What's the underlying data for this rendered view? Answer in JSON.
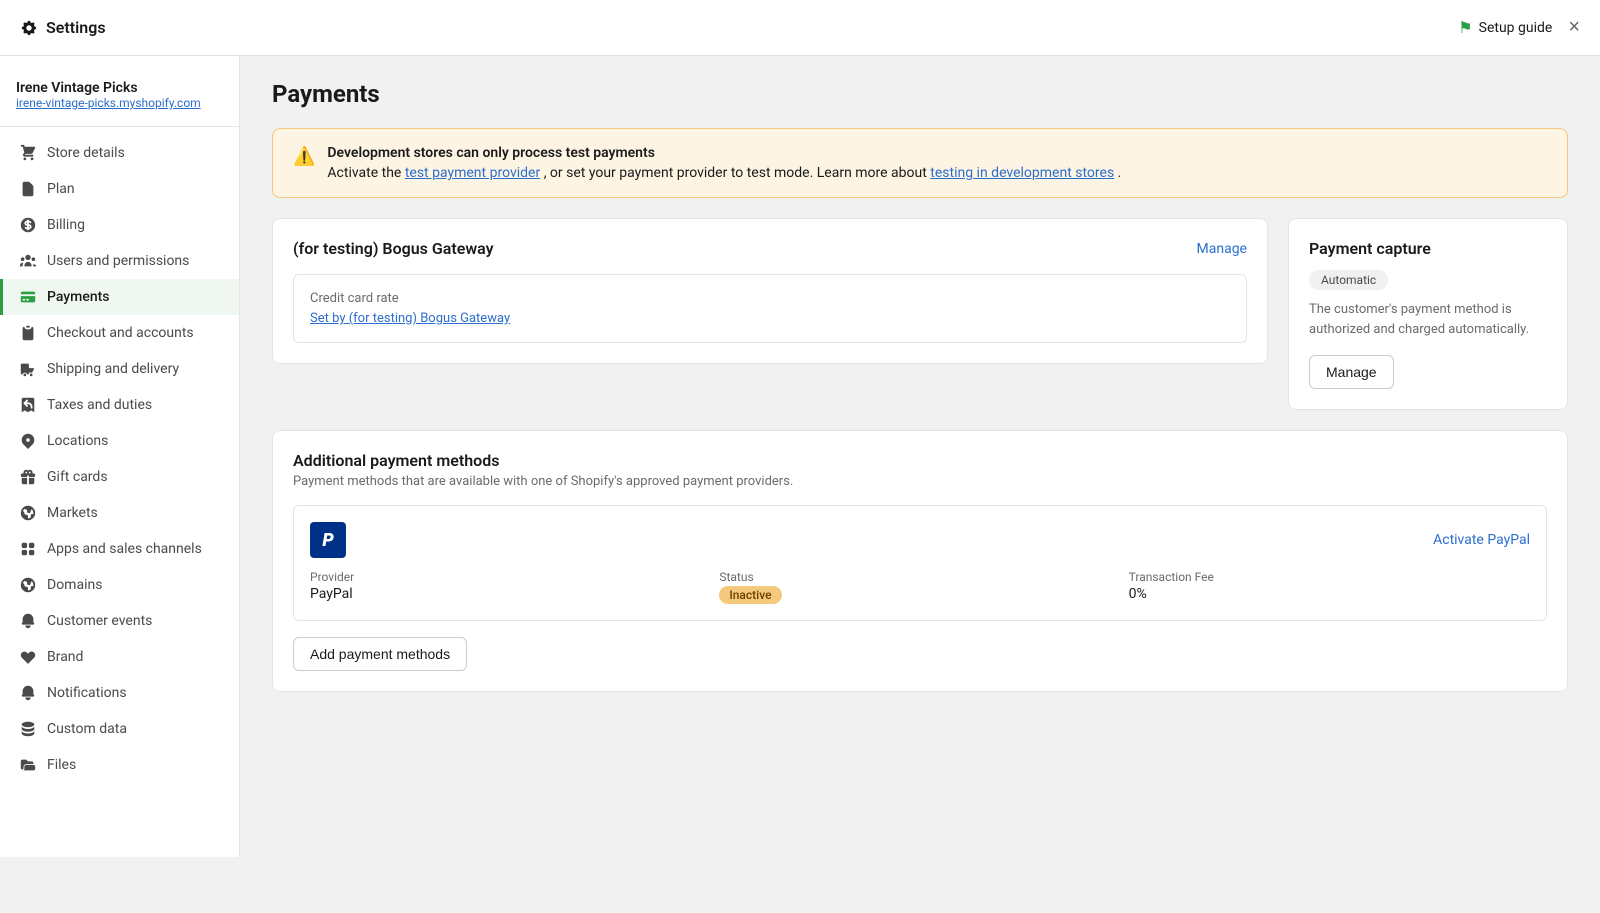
{
  "topbar": {
    "title": "Settings",
    "setup_guide_label": "Setup guide",
    "close_label": "×"
  },
  "sidebar": {
    "store_name": "Irene Vintage Picks",
    "store_url": "irene-vintage-picks.myshopify.com",
    "items": [
      {
        "id": "store-details",
        "label": "Store details",
        "icon": "store"
      },
      {
        "id": "plan",
        "label": "Plan",
        "icon": "plan"
      },
      {
        "id": "billing",
        "label": "Billing",
        "icon": "billing"
      },
      {
        "id": "users-permissions",
        "label": "Users and permissions",
        "icon": "users"
      },
      {
        "id": "payments",
        "label": "Payments",
        "icon": "payments",
        "active": true
      },
      {
        "id": "checkout-accounts",
        "label": "Checkout and accounts",
        "icon": "checkout"
      },
      {
        "id": "shipping-delivery",
        "label": "Shipping and delivery",
        "icon": "shipping"
      },
      {
        "id": "taxes-duties",
        "label": "Taxes and duties",
        "icon": "taxes"
      },
      {
        "id": "locations",
        "label": "Locations",
        "icon": "locations"
      },
      {
        "id": "gift-cards",
        "label": "Gift cards",
        "icon": "gift"
      },
      {
        "id": "markets",
        "label": "Markets",
        "icon": "markets"
      },
      {
        "id": "apps-channels",
        "label": "Apps and sales channels",
        "icon": "apps"
      },
      {
        "id": "domains",
        "label": "Domains",
        "icon": "domains"
      },
      {
        "id": "customer-events",
        "label": "Customer events",
        "icon": "events"
      },
      {
        "id": "brand",
        "label": "Brand",
        "icon": "brand"
      },
      {
        "id": "notifications",
        "label": "Notifications",
        "icon": "notifications"
      },
      {
        "id": "custom-data",
        "label": "Custom data",
        "icon": "custom"
      },
      {
        "id": "files",
        "label": "Files",
        "icon": "files"
      }
    ]
  },
  "page": {
    "title": "Payments",
    "alert": {
      "title": "Development stores can only process test payments",
      "description": "Activate the ",
      "link1_text": "test payment provider",
      "middle_text": ", or set your payment provider to test mode. Learn more about ",
      "link2_text": "testing in development stores",
      "end_text": "."
    },
    "gateway": {
      "name": "(for testing) Bogus Gateway",
      "manage_label": "Manage",
      "credit_card_rate_label": "Credit card rate",
      "credit_card_link": "Set by (for testing) Bogus Gateway"
    },
    "payment_capture": {
      "title": "Payment capture",
      "badge": "Automatic",
      "description": "The customer's payment method is authorized and charged automatically.",
      "manage_label": "Manage"
    },
    "additional_methods": {
      "title": "Additional payment methods",
      "description": "Payment methods that are available with one of Shopify's approved payment providers.",
      "paypal": {
        "activate_label": "Activate PayPal",
        "provider_label": "Provider",
        "provider_value": "PayPal",
        "status_label": "Status",
        "status_value": "Inactive",
        "fee_label": "Transaction Fee",
        "fee_value": "0%"
      },
      "add_button_label": "Add payment methods"
    }
  }
}
